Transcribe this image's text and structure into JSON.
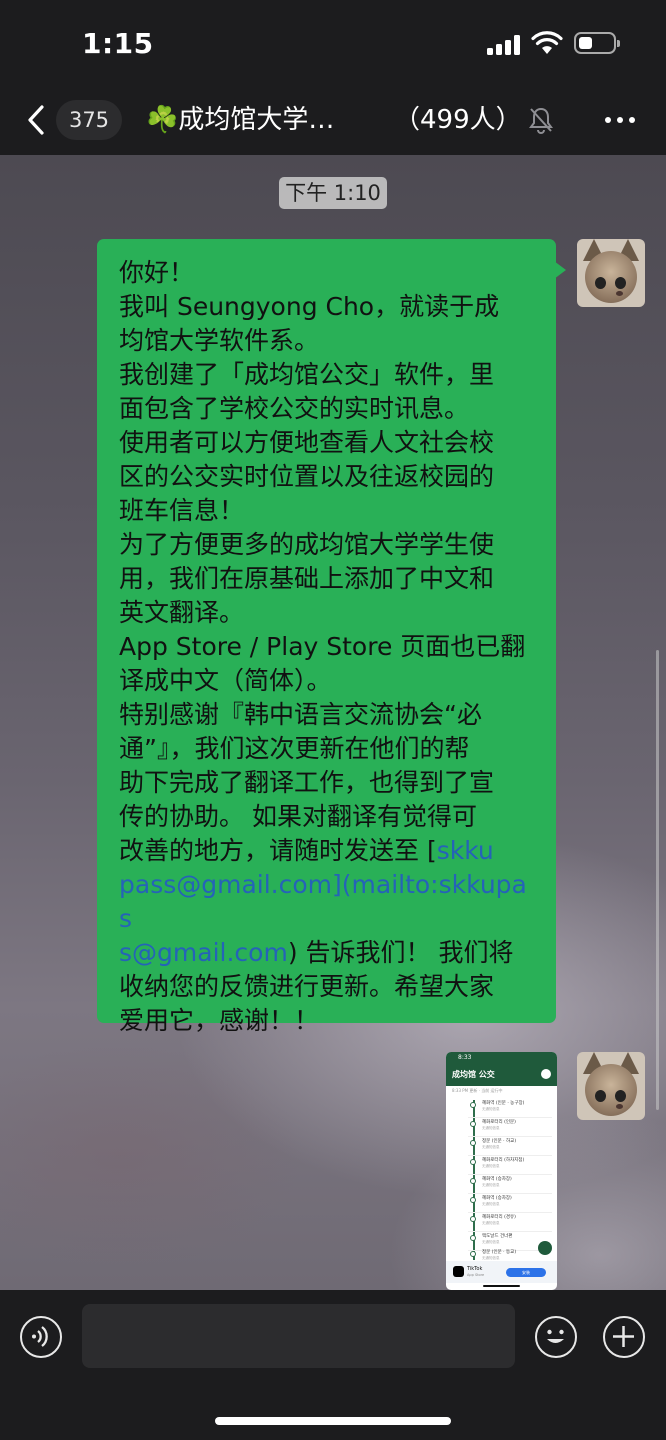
{
  "status_bar": {
    "time": "1:15"
  },
  "nav": {
    "unread_count": "375",
    "group_title": "☘️成均馆大学…",
    "member_count": "（499人）"
  },
  "chat": {
    "timestamp": "下午 1:10",
    "message_lines": [
      "你好！",
      "我叫 Seungyong Cho，就读于成",
      "均馆大学软件系。",
      "我创建了「成均馆公交」软件，里",
      "面包含了学校公交的实时讯息。",
      "使用者可以方便地查看人文社会校",
      "区的公交实时位置以及往返校园的",
      "班车信息！",
      "为了方便更多的成均馆大学学生使",
      "用，我们在原基础上添加了中文和",
      "英文翻译。",
      "App Store / Play Store 页面也已翻",
      "译成中文（简体）。",
      "特别感谢『韩中语言交流协会“必",
      "通”』，我们这次更新在他们的帮",
      "助下完成了翻译工作，也得到了宣",
      "传的协助。 如果对翻译有觉得可"
    ],
    "message_link_line_1_before": "改善的地方，请随时发送至 [",
    "message_link_line_1_link": "skku",
    "message_link_line_2": "pass@gmail.com](mailto:skkupas",
    "message_link_line_3_link": "s@gmail.com",
    "message_link_line_3_after": ") 告诉我们！ 我们将",
    "message_tail_lines": [
      "收纳您的反馈进行更新。希望大家",
      "爱用它，感谢！！"
    ],
    "image_preview": {
      "status_time": "8:33",
      "app_title": "成均馆 公交",
      "subtitle": "8:33 PM 更新 · 当前 运行中",
      "stops": [
        {
          "name": "혜화역 (인문 · 농구장)",
          "status": "无通知信息"
        },
        {
          "name": "혜화로터리 (인문)",
          "status": "无通知信息"
        },
        {
          "name": "정문 (인문 · 하교)",
          "status": "无通知信息"
        },
        {
          "name": "혜화로터리 (하차지점)",
          "status": "无通知信息"
        },
        {
          "name": "혜화역 (승차장)",
          "status": "无通知信息"
        },
        {
          "name": "혜화역 (승차장)",
          "status": "无通知信息"
        },
        {
          "name": "혜화로터리 (경유)",
          "status": "无通知信息"
        },
        {
          "name": "맥도날드 건너편",
          "status": "无通知信息"
        },
        {
          "name": "정문 (인문 · 등교)",
          "status": "无通知信息"
        }
      ],
      "ad_app": "TikTok",
      "ad_sub": "App Store",
      "ad_button": "安装"
    }
  },
  "input": {
    "placeholder": ""
  },
  "colors": {
    "bubble": "#29b057",
    "link": "#2563b8",
    "bar": "#1c1c1e"
  }
}
